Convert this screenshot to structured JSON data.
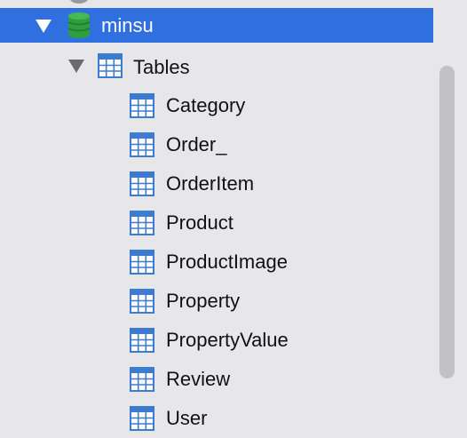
{
  "tree": {
    "database": {
      "name": "minsu",
      "icon": "database-icon",
      "expanded": true,
      "selected": true
    },
    "group": {
      "label": "Tables",
      "icon": "table-icon",
      "expanded": true
    },
    "tables": [
      {
        "name": "Category"
      },
      {
        "name": "Order_"
      },
      {
        "name": "OrderItem"
      },
      {
        "name": "Product"
      },
      {
        "name": "ProductImage"
      },
      {
        "name": "Property"
      },
      {
        "name": "PropertyValue"
      },
      {
        "name": "Review"
      },
      {
        "name": "User"
      }
    ]
  },
  "colors": {
    "selection": "#2f6fe0",
    "background": "#e7e7e9",
    "database_icon": "#2e9e3f",
    "table_icon": "#3d7bd0"
  }
}
